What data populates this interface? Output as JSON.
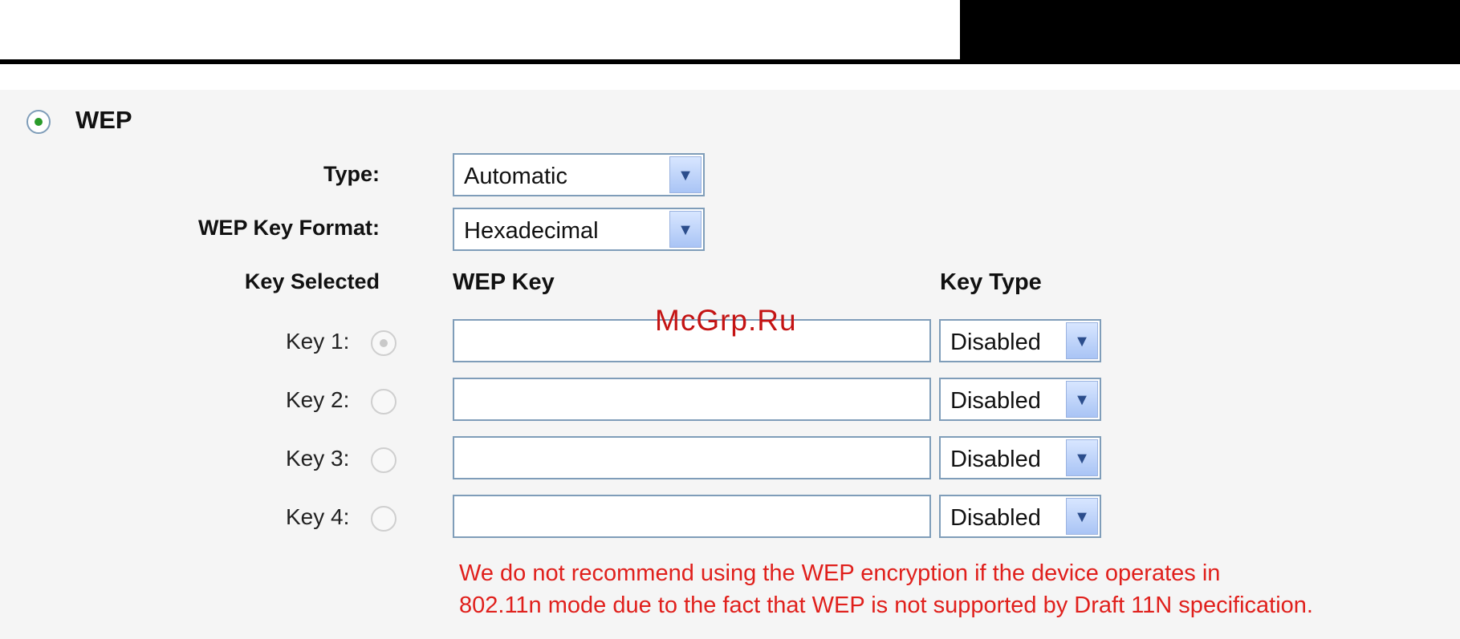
{
  "watermark": "McGrp.Ru",
  "wep": {
    "title": "WEP",
    "selected": true,
    "type_label": "Type:",
    "type_value": "Automatic",
    "format_label": "WEP Key Format:",
    "format_value": "Hexadecimal",
    "headers": {
      "key_selected": "Key Selected",
      "wep_key": "WEP Key",
      "key_type": "Key Type"
    },
    "keys": [
      {
        "label": "Key 1:",
        "selected": true,
        "value": "",
        "type": "Disabled"
      },
      {
        "label": "Key 2:",
        "selected": false,
        "value": "",
        "type": "Disabled"
      },
      {
        "label": "Key 3:",
        "selected": false,
        "value": "",
        "type": "Disabled"
      },
      {
        "label": "Key 4:",
        "selected": false,
        "value": "",
        "type": "Disabled"
      }
    ],
    "warning_line1": "We do not recommend using the WEP encryption if the device operates in",
    "warning_line2": "802.11n mode due to the fact that WEP is not supported by Draft 11N specification."
  },
  "icons": {
    "dropdown_arrow": "chevron-down-icon"
  }
}
